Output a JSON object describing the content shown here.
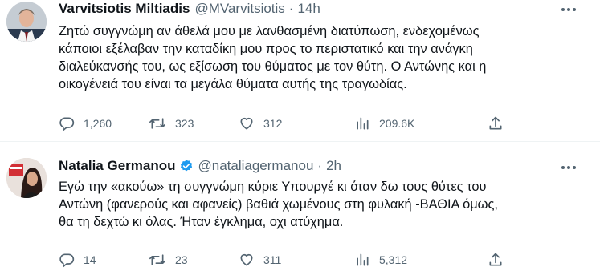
{
  "tweets": [
    {
      "author_name": "Varvitsiotis Miltiadis",
      "handle": "@MVarvitsiotis",
      "separator": "·",
      "time": "14h",
      "verified": false,
      "body_lines": [
        "Ζητώ συγγνώμη αν άθελά μου με λανθασμένη διατύπωση, ενδεχομένως",
        "κάποιοι εξέλαβαν την καταδίκη μου προς το περιστατικό και την ανάγκη",
        "διαλεύκανσής του, ως εξίσωση του θύματος με τον θύτη. Ο Αντώνης και η",
        "οικογένειά του είναι τα μεγάλα θύματα αυτής της τραγωδίας."
      ],
      "replies": "1,260",
      "retweets": "323",
      "likes": "312",
      "views": "209.6K",
      "icons": [
        "reply-icon",
        "retweet-icon",
        "like-icon",
        "views-icon",
        "share-icon",
        "more-icon"
      ]
    },
    {
      "author_name": "Natalia Germanou",
      "handle": "@nataliagermanou",
      "separator": "·",
      "time": "2h",
      "verified": true,
      "body_lines": [
        "Εγώ την «ακούω» τη συγγνώμη κύριε Υπουργέ κι όταν δω τους θύτες του",
        "Αντώνη (φανερούς και αφανείς) βαθιά χωμένους στη φυλακή -ΒΑΘΙΑ όμως,",
        "θα τη δεχτώ κι όλας. Ήταν έγκλημα, οχι ατύχημα."
      ],
      "replies": "14",
      "retweets": "23",
      "likes": "311",
      "views": "5,312",
      "icons": [
        "reply-icon",
        "retweet-icon",
        "like-icon",
        "views-icon",
        "share-icon",
        "more-icon",
        "verified-badge-icon"
      ]
    }
  ],
  "colors": {
    "text": "#0f1419",
    "secondary": "#536471",
    "verified_blue": "#1d9bf0",
    "divider": "#eff3f4"
  }
}
